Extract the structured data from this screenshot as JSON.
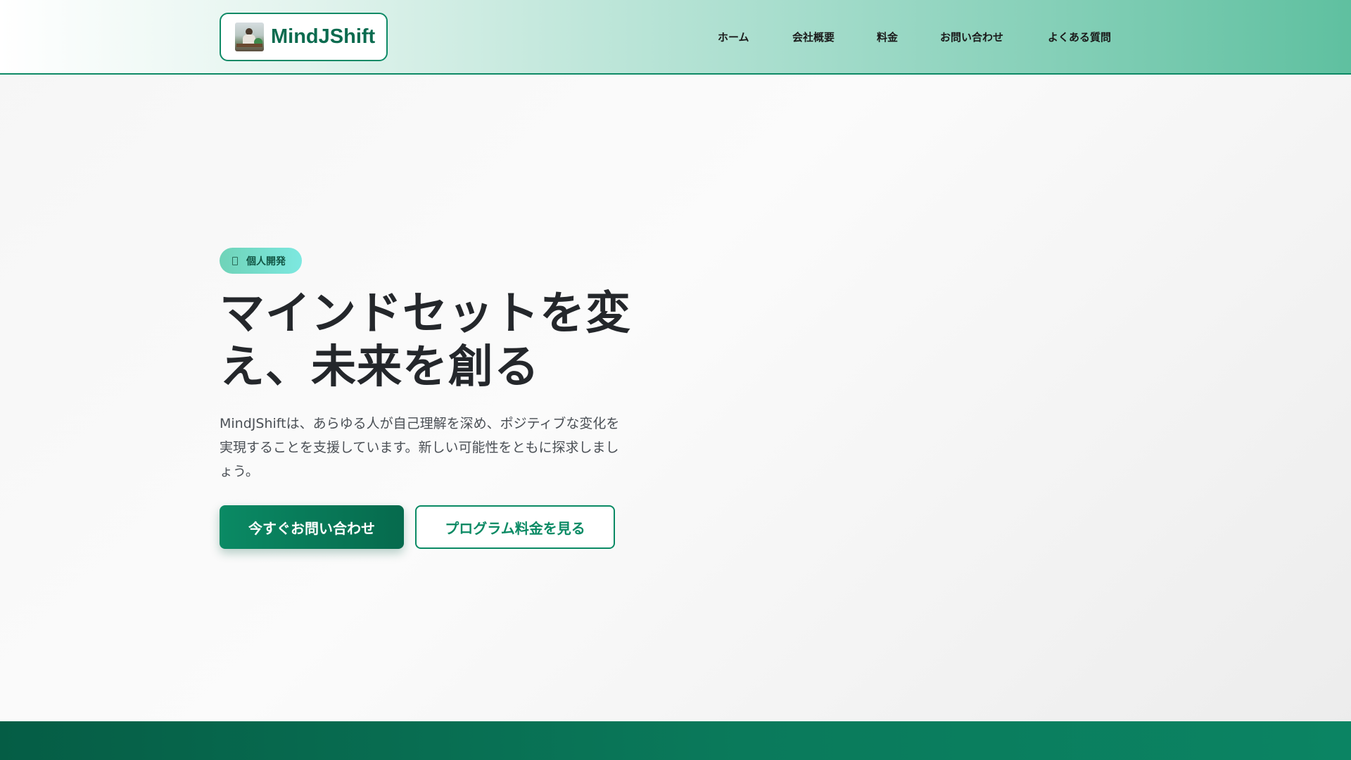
{
  "header": {
    "logo_text": "MindJShift"
  },
  "nav": {
    "items": [
      {
        "label": "ホーム"
      },
      {
        "label": "会社概要"
      },
      {
        "label": "料金"
      },
      {
        "label": "お問い合わせ"
      },
      {
        "label": "よくある質問"
      }
    ]
  },
  "hero": {
    "badge": "個人開発",
    "title": "マインドセットを変え、未来を創る",
    "description": "MindJShiftは、あらゆる人が自己理解を深め、ポジティブな変化を実現することを支援しています。新しい可能性をともに探求しましょう。",
    "primary_button": "今すぐお問い合わせ",
    "secondary_button": "プログラム料金を見る"
  },
  "colors": {
    "brand": "#0b6b4f",
    "accent": "#0a8a64",
    "badge_start": "#6fd3b8",
    "badge_end": "#7de8e0"
  }
}
